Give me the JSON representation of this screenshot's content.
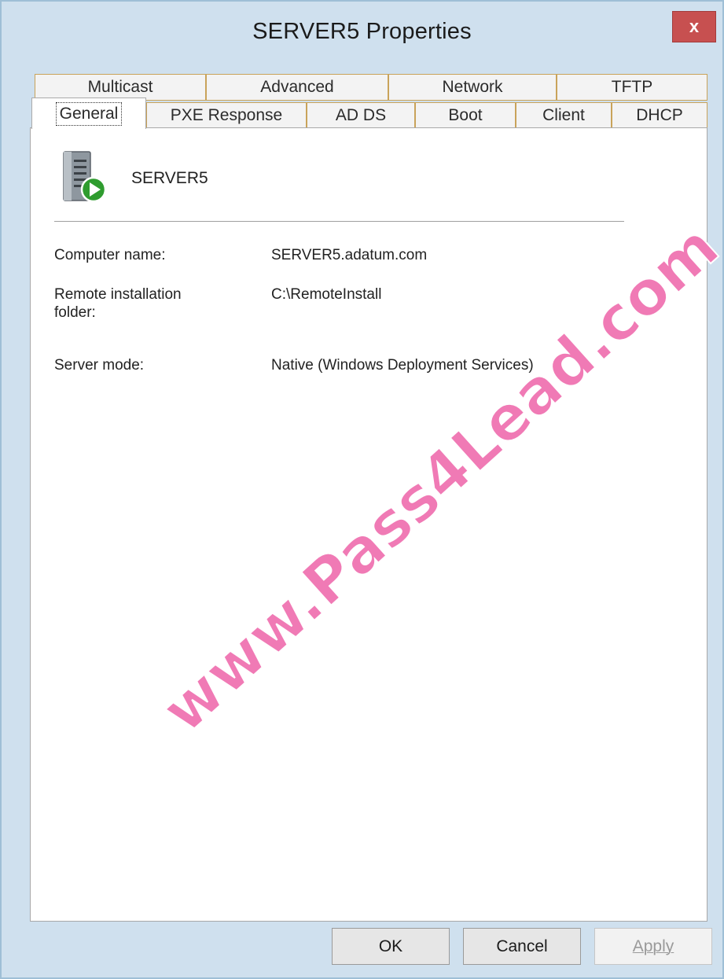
{
  "window": {
    "title": "SERVER5 Properties",
    "close_glyph": "x"
  },
  "tabs": {
    "back_row": [
      {
        "label": "Multicast"
      },
      {
        "label": "Advanced"
      },
      {
        "label": "Network"
      },
      {
        "label": "TFTP"
      }
    ],
    "front_row": [
      {
        "label": "General",
        "active": true
      },
      {
        "label": "PXE Response"
      },
      {
        "label": "AD DS"
      },
      {
        "label": "Boot"
      },
      {
        "label": "Client"
      },
      {
        "label": "DHCP"
      }
    ]
  },
  "general": {
    "server_icon": "server-icon",
    "server_name": "SERVER5",
    "fields": [
      {
        "label": "Computer name:",
        "value": "SERVER5.adatum.com"
      },
      {
        "label_line1": "Remote installation",
        "label_line2": "folder:",
        "value": "C:\\RemoteInstall"
      },
      {
        "label": "Server mode:",
        "value": "Native (Windows Deployment Services)"
      }
    ]
  },
  "buttons": {
    "ok": "OK",
    "cancel": "Cancel",
    "apply": "Apply"
  },
  "watermark": "www.Pass4Lead.com",
  "colors": {
    "close": "#c75050",
    "tab_border": "#c9a35a",
    "watermark": "#f07ab5"
  }
}
